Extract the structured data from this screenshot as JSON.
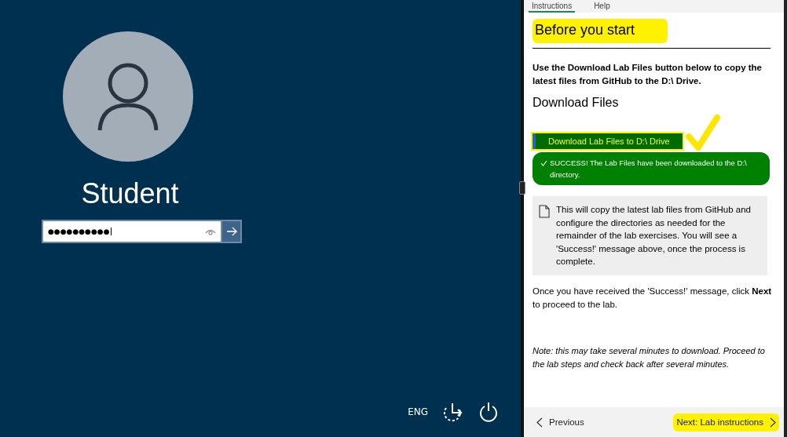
{
  "login": {
    "username": "Student",
    "password": {
      "value": "●●●●●●●●●●"
    },
    "language": "ENG"
  },
  "panel": {
    "tabs": [
      {
        "label": "Instructions",
        "selected": true
      },
      {
        "label": "Help",
        "selected": false
      }
    ],
    "heading": "Before you start",
    "heading_highlighted": true,
    "intro": "Use the Download Lab Files button below to copy the latest files from GitHub to the D:\\ Drive.",
    "section_title": "Download Files",
    "download_button": {
      "label": "Download Lab Files to D:\\ Drive",
      "highlighted": true
    },
    "success_message": "SUCCESS! The Lab Files have been downloaded to the D:\\ directory.",
    "note_box": "This will copy the latest lab files from GitHub and configure the directories as needed for the remainder of the lab exercises. You will see a 'Success!' message above, once the process is complete.",
    "next_hint": "Once you have received the 'Success!' message, click **Next** to proceed to the lab.",
    "footnote": "Note: this may take several minutes to download. Proceed to the lab steps and check back after several minutes.",
    "previous": {
      "label": "Previous"
    },
    "next": {
      "label": "Next: Lab instructions",
      "highlighted": true
    }
  }
}
